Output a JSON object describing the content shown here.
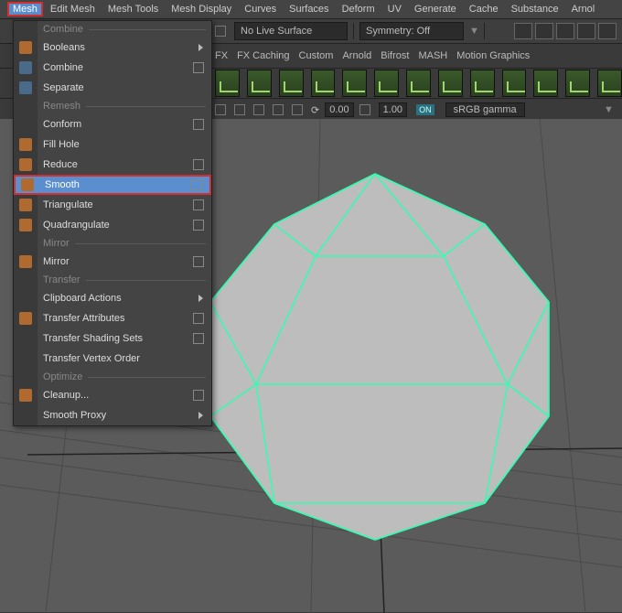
{
  "menubar": {
    "items": [
      "Mesh",
      "Edit Mesh",
      "Mesh Tools",
      "Mesh Display",
      "Curves",
      "Surfaces",
      "Deform",
      "UV",
      "Generate",
      "Cache",
      "Substance",
      "Arnol"
    ],
    "active_index": 0
  },
  "toprow": {
    "live_surface": "No Live Surface",
    "symmetry": "Symmetry: Off"
  },
  "shelf_tabs": [
    "FX",
    "FX Caching",
    "Custom",
    "Arnold",
    "Bifrost",
    "MASH",
    "Motion Graphics"
  ],
  "statusrow": {
    "num1": "0.00",
    "num2": "1.00",
    "on": "ON",
    "colorspace": "sRGB gamma"
  },
  "dropdown": {
    "groups": [
      {
        "label": "Combine",
        "items": [
          {
            "label": "Booleans",
            "icon": "org",
            "arrow": true
          },
          {
            "label": "Combine",
            "icon": "blu",
            "opt": true
          },
          {
            "label": "Separate",
            "icon": "blu"
          }
        ]
      },
      {
        "label": "Remesh",
        "items": [
          {
            "label": "Conform",
            "opt": true
          },
          {
            "label": "Fill Hole",
            "icon": "org"
          },
          {
            "label": "Reduce",
            "icon": "org",
            "opt": true
          },
          {
            "label": "Smooth",
            "icon": "org",
            "opt": true,
            "highlight": true
          }
        ]
      },
      {
        "label": "",
        "items": [
          {
            "label": "Triangulate",
            "icon": "org",
            "opt": true
          },
          {
            "label": "Quadrangulate",
            "icon": "org",
            "opt": true
          }
        ]
      },
      {
        "label": "Mirror",
        "items": [
          {
            "label": "Mirror",
            "icon": "org",
            "opt": true
          }
        ]
      },
      {
        "label": "Transfer",
        "items": [
          {
            "label": "Clipboard Actions",
            "arrow": true
          },
          {
            "label": "Transfer Attributes",
            "icon": "org",
            "opt": true
          },
          {
            "label": "Transfer Shading Sets",
            "opt": true
          },
          {
            "label": "Transfer Vertex Order"
          }
        ]
      },
      {
        "label": "Optimize",
        "items": [
          {
            "label": "Cleanup...",
            "icon": "org",
            "opt": true
          },
          {
            "label": "Smooth Proxy",
            "arrow": true
          }
        ]
      }
    ]
  }
}
